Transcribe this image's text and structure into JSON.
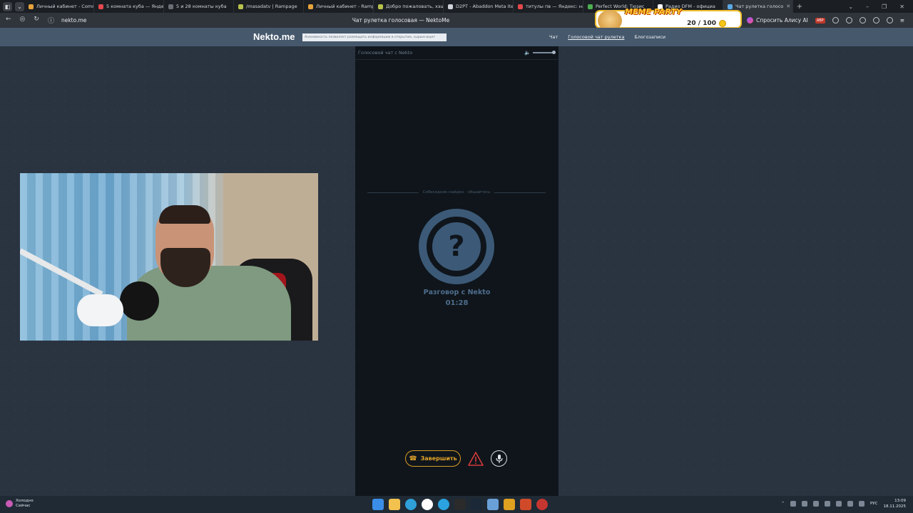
{
  "browser": {
    "tabs": [
      {
        "label": "Личный кабинет - Comm",
        "color": "#e7a33b"
      },
      {
        "label": "5 комната куба — Яндекс",
        "color": "#e5484d"
      },
      {
        "label": "5 и 28 комнаты куба",
        "color": "#6b6f75"
      },
      {
        "label": "/masadatv | Rampage",
        "color": "#b8c24a"
      },
      {
        "label": "Личный кабинет - Ramp",
        "color": "#e7a33b"
      },
      {
        "label": "Добро пожаловать, хэше",
        "color": "#b8c24a"
      },
      {
        "label": "D2PT - Abaddon Meta Ite",
        "color": "#cfd4da"
      },
      {
        "label": "титулы пв — Яндекс: най",
        "color": "#e5484d"
      },
      {
        "label": "Perfect World: Тюзис",
        "color": "#4caf50"
      },
      {
        "label": "Радио DFM - официа",
        "color": "#ffffff"
      },
      {
        "label": "Чат рулетка голосо",
        "color": "#5aa9e6",
        "active": true
      }
    ],
    "url": "nekto.me",
    "page_title": "Чат рулетка голосовая — NektoMe",
    "alice_label": "Спросить Алису AI",
    "abp_label": "ABP"
  },
  "overlay": {
    "title": "MEME PARTY",
    "count": "20 / 100"
  },
  "site": {
    "logo": "Nekto.me",
    "notice": "Анонимность позволяет размещать информацию в открытом, сырым ищет",
    "nav": [
      "Чат",
      "Голосовой чат рулетка",
      "Блогозаписи"
    ]
  },
  "chat": {
    "header": "Голосовой чат с Nekto",
    "found_text": "Собеседник найден · общайтесь",
    "avatar_symbol": "?",
    "talking_with": "Разговор с Nekto",
    "timer": "01:28",
    "end_button": "Завершить"
  },
  "taskbar": {
    "weather_line1": "Холодно",
    "weather_line2": "Сейчас",
    "lang": "РУС",
    "time": "13:09",
    "date": "18.11.2025"
  }
}
